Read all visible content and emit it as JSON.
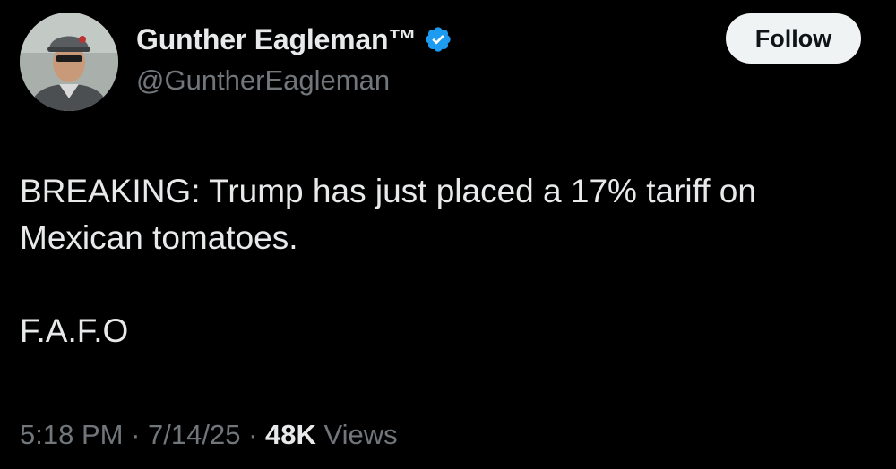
{
  "author": {
    "display_name": "Gunther Eagleman™",
    "handle": "@GuntherEagleman",
    "verified_icon": "verified-badge-icon",
    "verified_color": "#1d9bf0"
  },
  "follow_button": {
    "label": "Follow"
  },
  "tweet": {
    "line1": "BREAKING: Trump has just placed a 17% tariff on",
    "line2": "Mexican tomatoes.",
    "line3": "F.A.F.O"
  },
  "meta": {
    "time": "5:18 PM",
    "separator": "·",
    "date": "7/14/25",
    "views_count": "48K",
    "views_label": "Views"
  },
  "colors": {
    "background": "#000000",
    "primary_text": "#e7e9ea",
    "secondary_text": "#71767b",
    "button_bg": "#eff3f4"
  }
}
